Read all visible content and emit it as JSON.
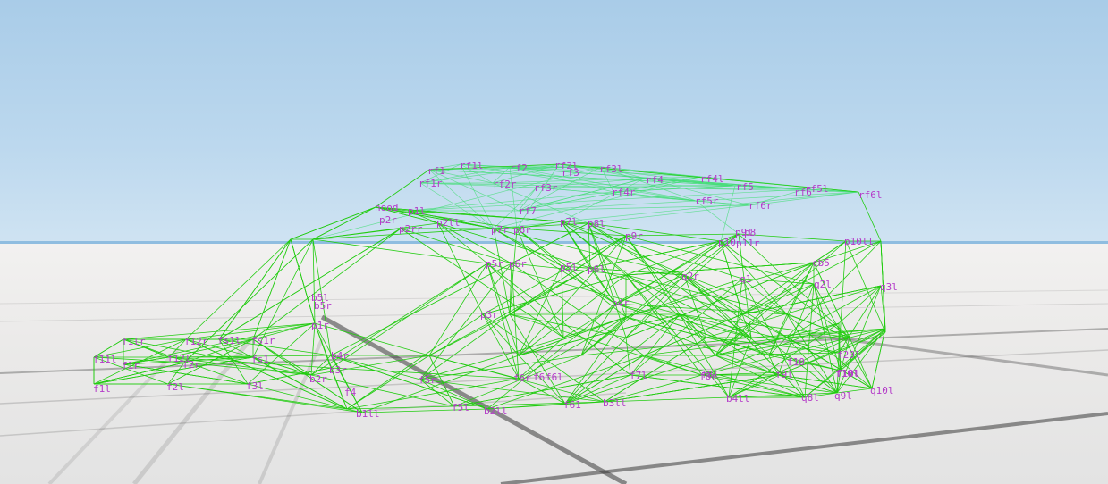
{
  "scene": {
    "sky_color": "#a9cce8",
    "ground_color": "#ebeae9",
    "grid_color": "#3a3a3a",
    "beam_color": "#22cc11",
    "label_color": "#b43cc8",
    "node_labels": [
      "rf1",
      "rf1l",
      "rf2",
      "rf2l",
      "rf3",
      "rf3l",
      "rf4l",
      "rf4",
      "rf5",
      "rf5l",
      "rf6",
      "rf6l",
      "rf1r",
      "rf2r",
      "rf3r",
      "rf4r",
      "rf5r",
      "rf6r",
      "rf7",
      "hood",
      "p1l",
      "p2r",
      "p2rr",
      "p2ll",
      "p7l",
      "p8l",
      "p7r",
      "p8r",
      "p9r",
      "p10",
      "p11r",
      "p10ll",
      "p9l",
      "p8",
      "p5r",
      "p6r",
      "p5l",
      "p6l",
      "p4r",
      "p3r",
      "p1r",
      "q2r",
      "q1",
      "q2l",
      "q3l",
      "cb5",
      "f1lr",
      "f12r",
      "fs1l",
      "fs1r",
      "f11l",
      "f1r",
      "f12l",
      "f2r",
      "fs1",
      "f1l",
      "f2l",
      "f3l",
      "b5r",
      "b5l",
      "b4r",
      "b3r",
      "b2r",
      "f5r",
      "f5l",
      "f6r",
      "f6",
      "f6l",
      "f7l",
      "f8r",
      "f8l",
      "f9l",
      "f10l",
      "f10",
      "b4ll",
      "q8l",
      "q9l",
      "q10l",
      "f20l",
      "f10l",
      "b2ll",
      "b3ll",
      "b1ll",
      "f61",
      "f4"
    ]
  }
}
